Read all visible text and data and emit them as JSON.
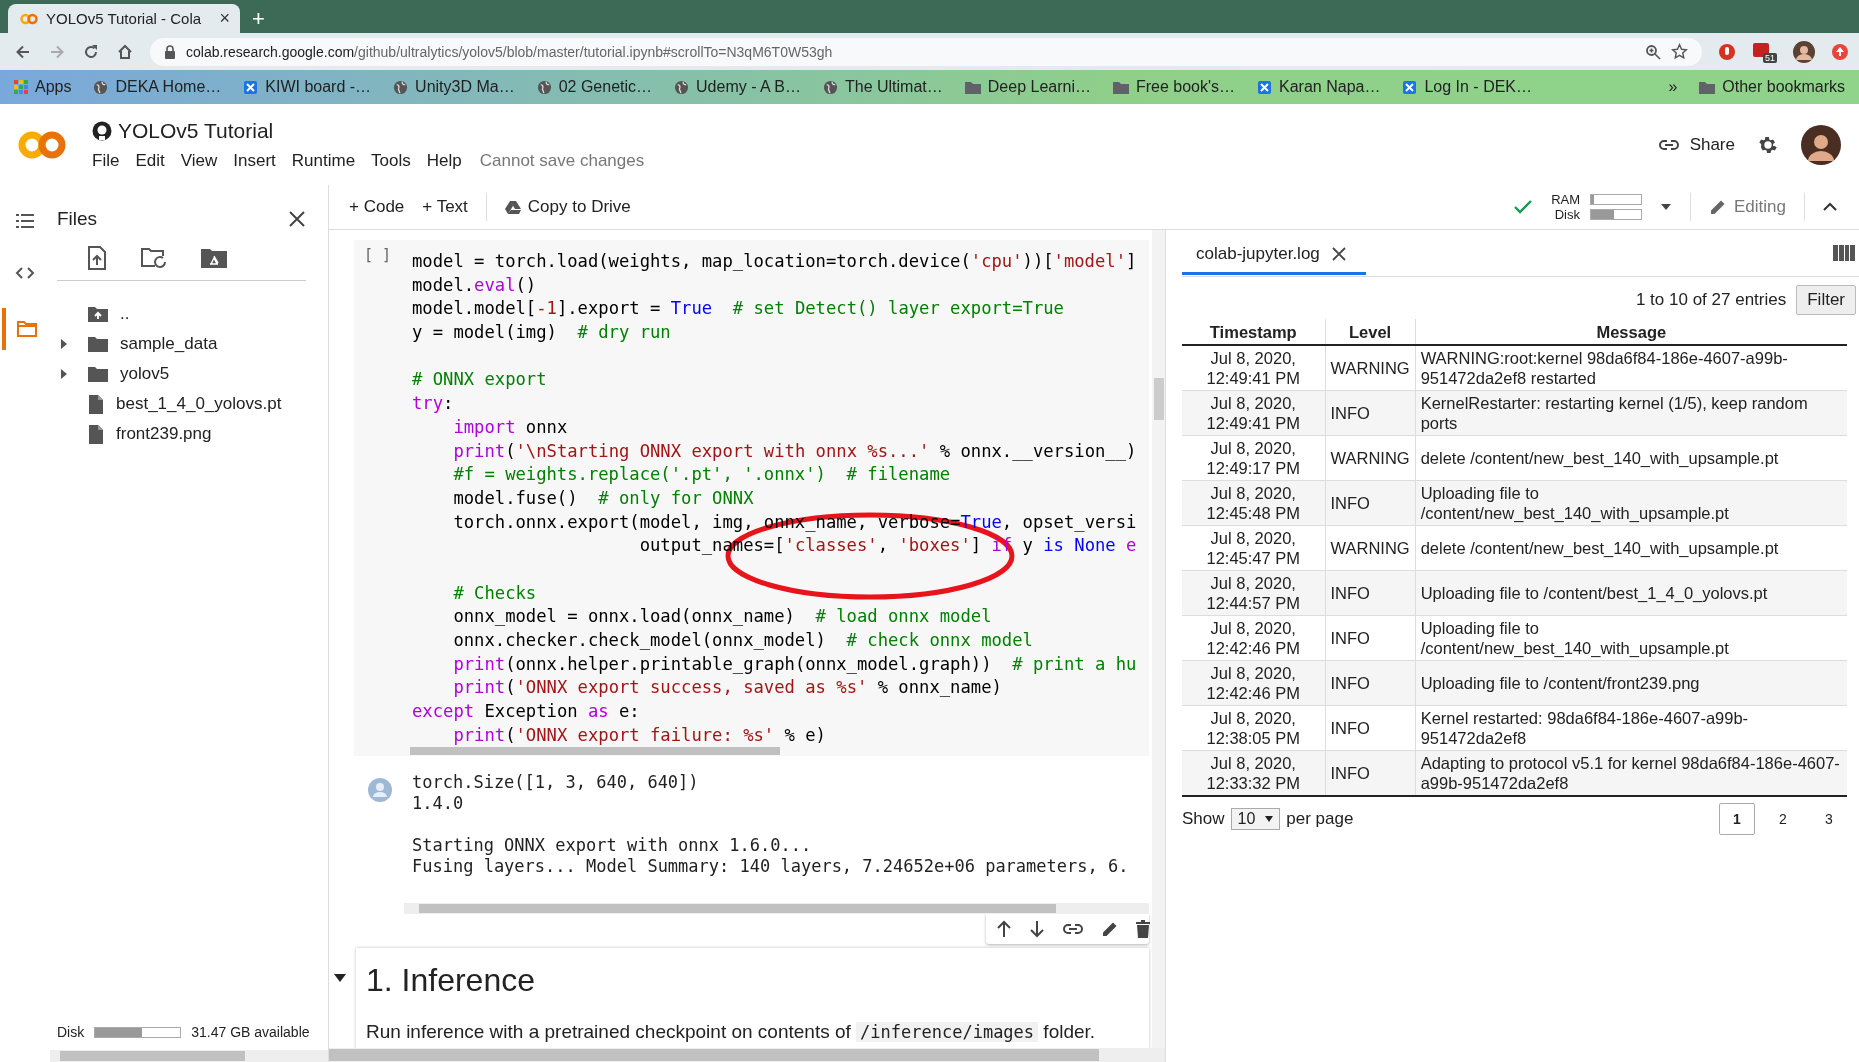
{
  "browser": {
    "tab": {
      "title": "YOLOv5 Tutorial - Cola",
      "close": "×"
    },
    "new_tab": "+",
    "url": {
      "host": "colab.research.google.com",
      "path": "/github/ultralytics/yolov5/blob/master/tutorial.ipynb#scrollTo=N3qM6T0W53gh"
    },
    "extension_badge": "51",
    "bookmarks": [
      {
        "label": "Apps",
        "kind": "apps"
      },
      {
        "label": "DEKA Home…",
        "kind": "globe"
      },
      {
        "label": "KIWI board -…",
        "kind": "tile"
      },
      {
        "label": "Unity3D Ma…",
        "kind": "globe"
      },
      {
        "label": "02 Genetic…",
        "kind": "globe"
      },
      {
        "label": "Udemy - A B…",
        "kind": "globe"
      },
      {
        "label": "The Ultimat…",
        "kind": "globe"
      },
      {
        "label": "Deep Learni…",
        "kind": "folder"
      },
      {
        "label": "Free book's…",
        "kind": "folder"
      },
      {
        "label": "Karan Napa…",
        "kind": "tile"
      },
      {
        "label": "Log In - DEK…",
        "kind": "tile"
      }
    ],
    "more": "»",
    "other_bookmarks": "Other bookmarks"
  },
  "notebook": {
    "title": "YOLOv5 Tutorial",
    "menu": [
      "File",
      "Edit",
      "View",
      "Insert",
      "Runtime",
      "Tools",
      "Help"
    ],
    "save_status": "Cannot save changes",
    "share": "Share"
  },
  "toolbar": {
    "add_code": "+ Code",
    "add_text": "+ Text",
    "copy": "Copy to Drive",
    "ram": {
      "label": "RAM",
      "level": 0.06
    },
    "disk": {
      "label": "Disk",
      "level": 0.45
    },
    "mode": "Editing"
  },
  "sidebar": {
    "title": "Files",
    "tree": [
      {
        "name": "..",
        "kind": "parent"
      },
      {
        "name": "sample_data",
        "kind": "folder",
        "expanded": false
      },
      {
        "name": "yolov5",
        "kind": "folder",
        "expanded": false
      },
      {
        "name": "best_1_4_0_yolovs.pt",
        "kind": "file"
      },
      {
        "name": "front239.png",
        "kind": "file"
      }
    ],
    "disk": {
      "label": "Disk",
      "level": 0.55,
      "available": "31.47 GB available"
    }
  },
  "code_cell": {
    "run_label": "[ ]",
    "lines": [
      {
        "kind": "code",
        "tokens": [
          {
            "kind": "plain",
            "text": "model = torch.load(weights, map_location=torch.device("
          },
          {
            "kind": "str",
            "text": "'cpu'"
          },
          {
            "kind": "plain",
            "text": "))["
          },
          {
            "kind": "str",
            "text": "'model'"
          },
          {
            "kind": "plain",
            "text": "]"
          }
        ]
      },
      {
        "kind": "code",
        "tokens": [
          {
            "kind": "plain",
            "text": "model."
          },
          {
            "kind": "kw",
            "text": "eval"
          },
          {
            "kind": "plain",
            "text": "()"
          }
        ]
      },
      {
        "kind": "code",
        "tokens": [
          {
            "kind": "plain",
            "text": "model.model["
          },
          {
            "kind": "num",
            "text": "-1"
          },
          {
            "kind": "plain",
            "text": "].export = "
          },
          {
            "kind": "bi",
            "text": "True"
          },
          {
            "kind": "cm",
            "text": "  # set Detect() layer export=True"
          }
        ]
      },
      {
        "kind": "code",
        "tokens": [
          {
            "kind": "plain",
            "text": "y = model(img)"
          },
          {
            "kind": "cm",
            "text": "  # dry run"
          }
        ]
      },
      {
        "kind": "blank"
      },
      {
        "kind": "code",
        "tokens": [
          {
            "kind": "cm",
            "text": "# ONNX export"
          }
        ]
      },
      {
        "kind": "code",
        "tokens": [
          {
            "kind": "kw",
            "text": "try"
          },
          {
            "kind": "plain",
            "text": ":"
          }
        ]
      },
      {
        "kind": "code",
        "tokens": [
          {
            "kind": "kw",
            "text": "    import"
          },
          {
            "kind": "plain",
            "text": " onnx"
          }
        ]
      },
      {
        "kind": "code",
        "tokens": [
          {
            "kind": "kw",
            "text": "    print"
          },
          {
            "kind": "plain",
            "text": "("
          },
          {
            "kind": "str",
            "text": "'\\nStarting ONNX export with onnx %s...'"
          },
          {
            "kind": "plain",
            "text": " % onnx.__version__)"
          }
        ]
      },
      {
        "kind": "code",
        "tokens": [
          {
            "kind": "cm",
            "text": "    #f = weights.replace('.pt', '.onnx')  # filename"
          }
        ]
      },
      {
        "kind": "code",
        "tokens": [
          {
            "kind": "plain",
            "text": "    model.fuse()"
          },
          {
            "kind": "cm",
            "text": "  # only for ONNX"
          }
        ]
      },
      {
        "kind": "code",
        "tokens": [
          {
            "kind": "plain",
            "text": "    torch.onnx.export(model, img, onnx_name, verbose="
          },
          {
            "kind": "bi",
            "text": "True"
          },
          {
            "kind": "plain",
            "text": ", opset_versi"
          }
        ]
      },
      {
        "kind": "code",
        "tokens": [
          {
            "kind": "plain",
            "text": "                      output_names=["
          },
          {
            "kind": "str",
            "text": "'classes'"
          },
          {
            "kind": "plain",
            "text": ", "
          },
          {
            "kind": "str",
            "text": "'boxes'"
          },
          {
            "kind": "plain",
            "text": "] "
          },
          {
            "kind": "kw",
            "text": "if"
          },
          {
            "kind": "plain",
            "text": " y "
          },
          {
            "kind": "bi",
            "text": "is None"
          },
          {
            "kind": "kw",
            "text": " e"
          }
        ]
      },
      {
        "kind": "blank"
      },
      {
        "kind": "code",
        "tokens": [
          {
            "kind": "cm",
            "text": "    # Checks"
          }
        ]
      },
      {
        "kind": "code",
        "tokens": [
          {
            "kind": "plain",
            "text": "    onnx_model = onnx.load(onnx_name)"
          },
          {
            "kind": "cm",
            "text": "  # load onnx model"
          }
        ]
      },
      {
        "kind": "code",
        "tokens": [
          {
            "kind": "plain",
            "text": "    onnx.checker.check_model(onnx_model)"
          },
          {
            "kind": "cm",
            "text": "  # check onnx model"
          }
        ]
      },
      {
        "kind": "code",
        "tokens": [
          {
            "kind": "kw",
            "text": "    print"
          },
          {
            "kind": "plain",
            "text": "(onnx.helper.printable_graph(onnx_model.graph))"
          },
          {
            "kind": "cm",
            "text": "  # print a hu"
          }
        ]
      },
      {
        "kind": "code",
        "tokens": [
          {
            "kind": "kw",
            "text": "    print"
          },
          {
            "kind": "plain",
            "text": "("
          },
          {
            "kind": "str",
            "text": "'ONNX export success, saved as %s'"
          },
          {
            "kind": "plain",
            "text": " % onnx_name)"
          }
        ]
      },
      {
        "kind": "code",
        "tokens": [
          {
            "kind": "kw",
            "text": "except"
          },
          {
            "kind": "plain",
            "text": " Exception "
          },
          {
            "kind": "kw",
            "text": "as"
          },
          {
            "kind": "plain",
            "text": " e:"
          }
        ]
      },
      {
        "kind": "code",
        "tokens": [
          {
            "kind": "kw",
            "text": "    print"
          },
          {
            "kind": "plain",
            "text": "("
          },
          {
            "kind": "str",
            "text": "'ONNX export failure: %s'"
          },
          {
            "kind": "plain",
            "text": " % e)"
          }
        ]
      }
    ],
    "output": [
      [
        "torch.Size([1, 3, 640, 640])",
        "1.4.0"
      ],
      [
        "Starting ONNX export with onnx 1.6.0...",
        "Fusing layers... Model Summary: 140 layers, 7.24652e+06 parameters, 6."
      ]
    ]
  },
  "text_cell": {
    "expanded": true,
    "heading": "1. Inference",
    "paragraph": [
      {
        "kind": "text",
        "text": "Run inference with a pretrained checkpoint on contents of "
      },
      {
        "kind": "code",
        "text": "/inference/images"
      },
      {
        "kind": "text",
        "text": " folder."
      }
    ]
  },
  "log_panel": {
    "tab": "colab-jupyter.log",
    "entries_info": "1 to 10 of 27 entries",
    "filter": "Filter",
    "columns": [
      "Timestamp",
      "Level",
      "Message"
    ],
    "rows": [
      {
        "timestamp": "Jul 8, 2020, 12:49:41 PM",
        "level": "WARNING",
        "message": "WARNING:root:kernel 98da6f84-186e-4607-a99b-951472da2ef8 restarted"
      },
      {
        "timestamp": "Jul 8, 2020, 12:49:41 PM",
        "level": "INFO",
        "message": "KernelRestarter: restarting kernel (1/5), keep random ports"
      },
      {
        "timestamp": "Jul 8, 2020, 12:49:17 PM",
        "level": "WARNING",
        "message": "delete /content/new_best_140_with_upsample.pt"
      },
      {
        "timestamp": "Jul 8, 2020, 12:45:48 PM",
        "level": "INFO",
        "message": "Uploading file to /content/new_best_140_with_upsample.pt"
      },
      {
        "timestamp": "Jul 8, 2020, 12:45:47 PM",
        "level": "WARNING",
        "message": "delete /content/new_best_140_with_upsample.pt"
      },
      {
        "timestamp": "Jul 8, 2020, 12:44:57 PM",
        "level": "INFO",
        "message": "Uploading file to /content/best_1_4_0_yolovs.pt"
      },
      {
        "timestamp": "Jul 8, 2020, 12:42:46 PM",
        "level": "INFO",
        "message": "Uploading file to /content/new_best_140_with_upsample.pt"
      },
      {
        "timestamp": "Jul 8, 2020, 12:42:46 PM",
        "level": "INFO",
        "message": "Uploading file to /content/front239.png"
      },
      {
        "timestamp": "Jul 8, 2020, 12:38:05 PM",
        "level": "INFO",
        "message": "Kernel restarted: 98da6f84-186e-4607-a99b-951472da2ef8"
      },
      {
        "timestamp": "Jul 8, 2020, 12:33:32 PM",
        "level": "INFO",
        "message": "Adapting to protocol v5.1 for kernel 98da6f84-186e-4607-a99b-951472da2ef8"
      }
    ],
    "show": "Show",
    "per_page": "10",
    "per_page_suffix": "per page",
    "pages": [
      {
        "label": "1",
        "selected": true
      },
      {
        "label": "2",
        "selected": false
      },
      {
        "label": "3",
        "selected": false
      }
    ]
  }
}
